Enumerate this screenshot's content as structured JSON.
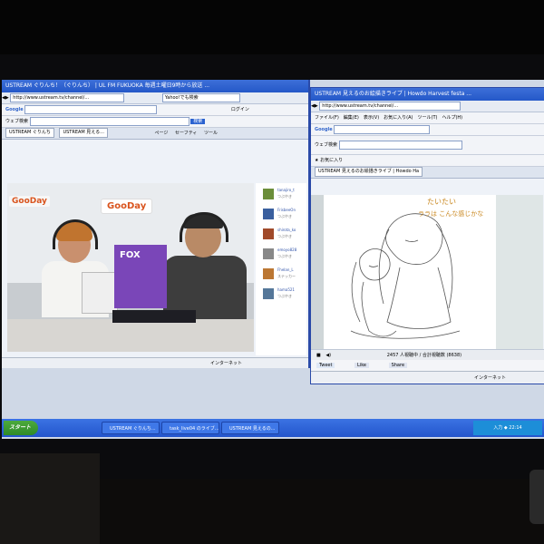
{
  "left_window": {
    "title": "USTREAM ぐりんち！（ぐりんち） | UL FM FUKUOKA 毎週土曜日9時から放送 ...",
    "address": "http://www.ustream.tv/channel/...",
    "search_box": "Yahoo!でも検索",
    "google_label": "Google",
    "login_label": "ログイン",
    "search_button": "ウェブ検索",
    "tab_label": "USTREAM ぐりんち",
    "tab2_label": "USTREAM 見える...",
    "menu_page": "ページ",
    "menu_safety": "セーフティ",
    "menu_tools": "ツール",
    "logo_text": "GooDay",
    "poster_text": "FOX",
    "chat_users": [
      {
        "name": "tanajiro_t",
        "sub": "つぶやき",
        "color": "#6b8e3a"
      },
      {
        "name": "FrisbeeOn",
        "sub": "つぶやき",
        "color": "#3a5f9e"
      },
      {
        "name": "shirota_ko",
        "sub": "つぶやき",
        "color": "#a04a2a"
      },
      {
        "name": "emoyo828",
        "sub": "つぶやき",
        "color": "#888888"
      },
      {
        "name": "Fhelan_L",
        "sub": "ステッカー",
        "color": "#bb7733"
      },
      {
        "name": "hama521",
        "sub": "つぶやき",
        "color": "#557799"
      }
    ],
    "status": "インターネット"
  },
  "right_window": {
    "title": "USTREAM 見えるのお絵描きライブ | Howdo Harvest festa ...",
    "address": "http://www.ustream.tv/channel/...",
    "menu": [
      "ファイル(F)",
      "編集(E)",
      "表示(V)",
      "お気に入り(A)",
      "ツール(T)",
      "ヘルプ(H)"
    ],
    "google_label": "Google",
    "search_button": "ウェブ検索",
    "favorites_label": "お気に入り",
    "tab_label": "USTREAM 見えるのお絵描きライブ | Howdo Ha",
    "handwriting_1": "たいたい",
    "handwriting_2": "ララは こんな感じかな",
    "viewer_count": "2457 人視聴中 / 合計視聴数 (8638)",
    "share_items": [
      "Tweet",
      "Like",
      "Share"
    ],
    "status": "インターネット"
  },
  "taskbar": {
    "start_label": "スタート",
    "items": [
      "USTREAM ぐりんち...",
      "task_live04 のライブ...",
      "USTREAM 見えるの..."
    ],
    "tray_text": "入力 ◆ 22:14"
  }
}
